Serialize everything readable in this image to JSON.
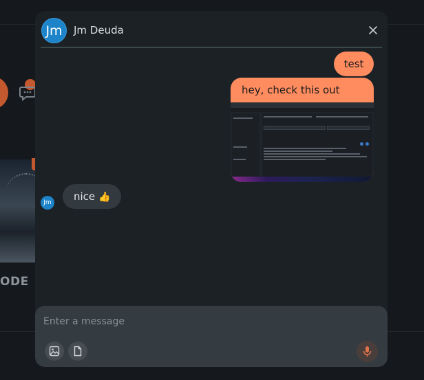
{
  "background": {
    "card_caption": "ODE"
  },
  "chat": {
    "contact_name": "Jm Deuda",
    "avatar_initials": "Jm",
    "messages": [
      {
        "direction": "outgoing",
        "text": "test"
      },
      {
        "direction": "outgoing",
        "text": "hey, check this out",
        "attachment": "screenshot-image"
      },
      {
        "direction": "incoming",
        "text": "nice 👍"
      }
    ],
    "incoming_text": "nice",
    "incoming_emoji": "👍"
  },
  "composer": {
    "placeholder": "Enter a message"
  },
  "icons": {
    "close": "close-icon",
    "image": "image-icon",
    "file": "file-icon",
    "mic": "microphone-icon",
    "bg_chat": "chat-bubble-icon"
  },
  "colors": {
    "outgoing_bubble": "#ff8c5f",
    "incoming_bubble": "#323a3f",
    "avatar": "#1e84c9",
    "dialog": "#1c2125",
    "composer": "#343c41",
    "mic": "#e0734a"
  }
}
